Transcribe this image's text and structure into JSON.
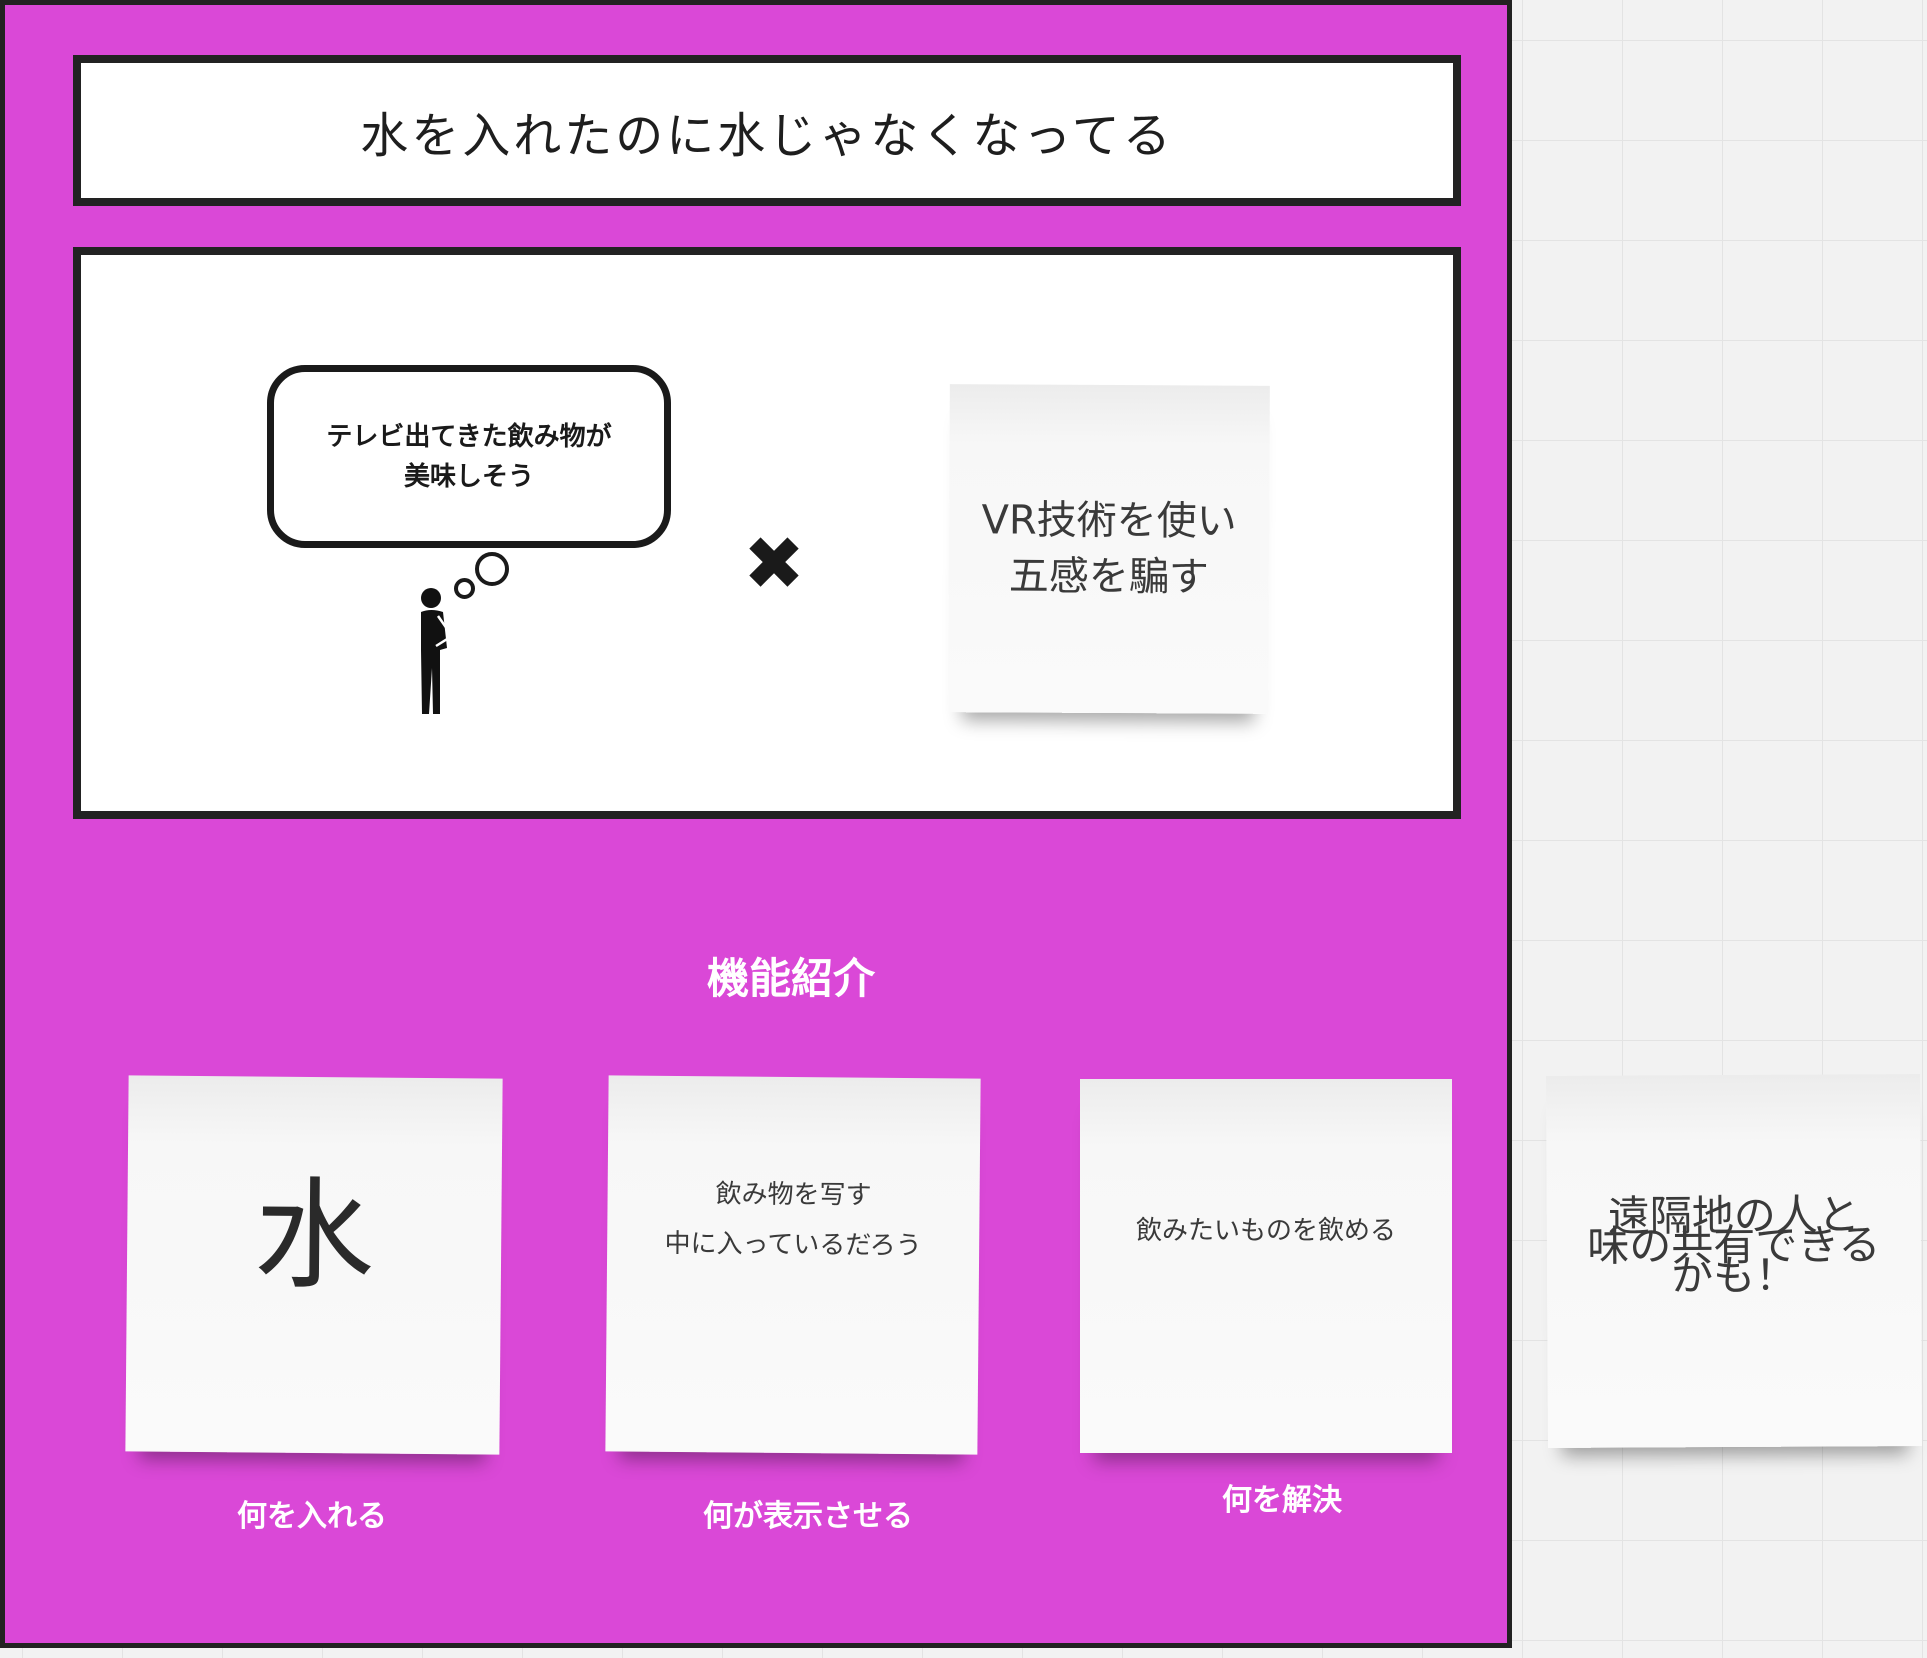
{
  "title": "水を入れたのに水じゃなくなってる",
  "scene": {
    "thought_line1": "テレビ出てきた飲み物が",
    "thought_line2": "美味しそう",
    "times_symbol": "✖",
    "vr_note_line1": "VR技術を使い",
    "vr_note_line2": "五感を騙す"
  },
  "features": {
    "heading": "機能紹介",
    "note1": "水",
    "note1_label": "何を入れる",
    "note2_line1": "中に入っているだろう",
    "note2_line2": "飲み物を写す",
    "note2_label": "何が表示させる",
    "note3": "飲みたいものを飲める",
    "note3_label": "何を解決"
  },
  "side_note": {
    "line1": "遠隔地の人と",
    "line2": "味の共有できる",
    "line3": "かも！"
  },
  "colors": {
    "frame_bg": "#da48d7",
    "border": "#222222",
    "canvas_bg": "#f2f2f2"
  }
}
